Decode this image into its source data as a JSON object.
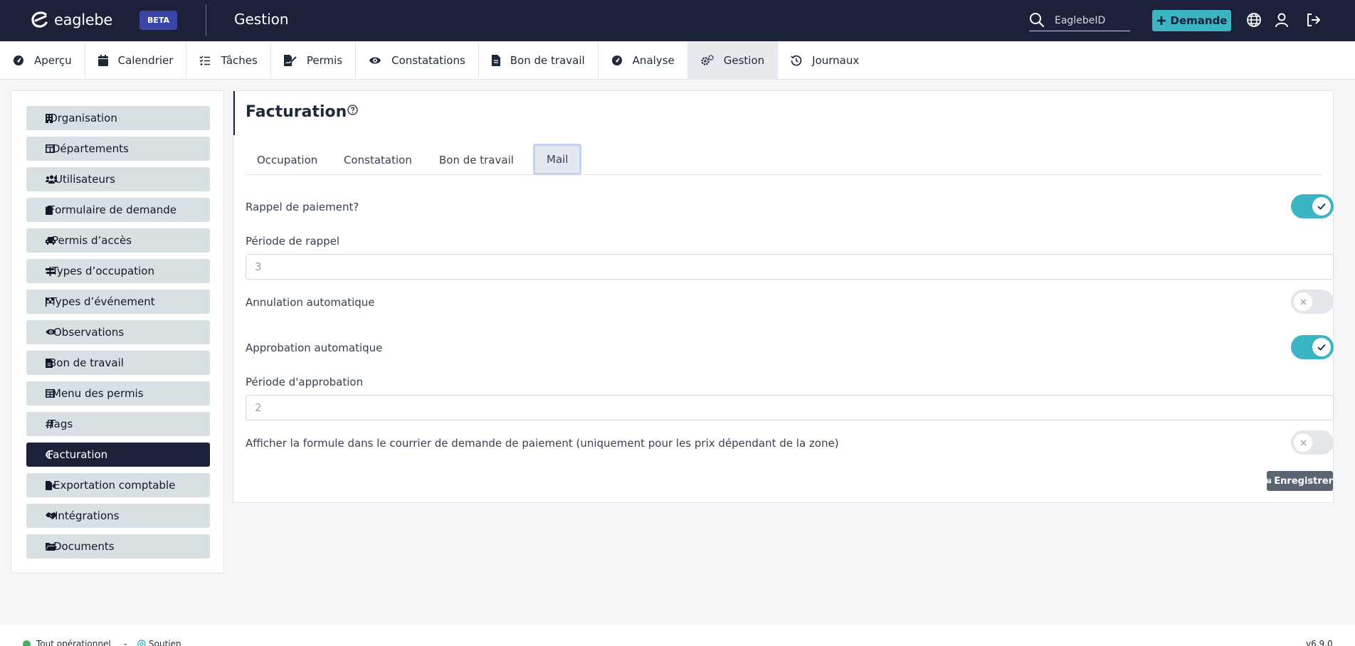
{
  "header": {
    "logo_text": "eaglebe",
    "beta_badge": "BETA",
    "app_title": "Gestion",
    "search_placeholder": "EaglebeID",
    "new_request_label": "Demande"
  },
  "nav": {
    "tabs": [
      {
        "label": "Aperçu",
        "icon": "gauge-icon"
      },
      {
        "label": "Calendrier",
        "icon": "calendar-icon"
      },
      {
        "label": "Tâches",
        "icon": "checklist-icon"
      },
      {
        "label": "Permis",
        "icon": "file-signature-icon"
      },
      {
        "label": "Constatations",
        "icon": "eye-icon"
      },
      {
        "label": "Bon de travail",
        "icon": "file-icon"
      },
      {
        "label": "Analyse",
        "icon": "gauge-icon"
      },
      {
        "label": "Gestion",
        "icon": "gears-icon"
      },
      {
        "label": "Journaux",
        "icon": "history-icon"
      }
    ],
    "active": "Gestion"
  },
  "sidebar": {
    "items": [
      {
        "label": "Organisation",
        "icon": "building-icon"
      },
      {
        "label": "Départements",
        "icon": "table-icon"
      },
      {
        "label": "Utilisateurs",
        "icon": "users-icon"
      },
      {
        "label": "Formulaire de demande",
        "icon": "clipboard-icon"
      },
      {
        "label": "Permis d’accès",
        "icon": "car-icon"
      },
      {
        "label": "Types d’occupation",
        "icon": "signs-icon"
      },
      {
        "label": "Types d’événement",
        "icon": "flag-checkered-icon"
      },
      {
        "label": "Observations",
        "icon": "eye-icon"
      },
      {
        "label": "Bon de travail",
        "icon": "file-icon"
      },
      {
        "label": "Menu des permis",
        "icon": "table-icon"
      },
      {
        "label": "Tags",
        "icon": "hashtag-icon"
      },
      {
        "label": "Facturation",
        "icon": "euro-icon"
      },
      {
        "label": "Exportation comptable",
        "icon": "file-export-icon"
      },
      {
        "label": "Intégrations",
        "icon": "handshake-icon"
      },
      {
        "label": "Documents",
        "icon": "folder-open-icon"
      }
    ],
    "active": "Facturation"
  },
  "main": {
    "title": "Facturation",
    "subtabs": [
      "Occupation",
      "Constatation",
      "Bon de travail",
      "Mail"
    ],
    "active_subtab": "Mail",
    "fields": {
      "payment_reminder": {
        "label": "Rappel de paiement?",
        "enabled": true
      },
      "reminder_period": {
        "label": "Période de rappel",
        "value": "3"
      },
      "auto_cancel": {
        "label": "Annulation automatique",
        "enabled": false
      },
      "auto_approval": {
        "label": "Approbation automatique",
        "enabled": true
      },
      "approval_period": {
        "label": "Période d'approbation",
        "value": "2"
      },
      "show_formula": {
        "label": "Afficher la formule dans le courrier de demande de paiement (uniquement pour les prix dépendant de la zone)",
        "enabled": false
      }
    },
    "save_label": "Enregistrer"
  },
  "footer": {
    "status": "Tout opérationnel",
    "separator": "-",
    "support": "Soutien",
    "version": "v6.9.0"
  },
  "colors": {
    "navy": "#1a2139",
    "accent": "#3bb5c3",
    "beta": "#3a47a6",
    "sidebar_item": "#d8e0e3",
    "status_ok": "#4caf62"
  }
}
